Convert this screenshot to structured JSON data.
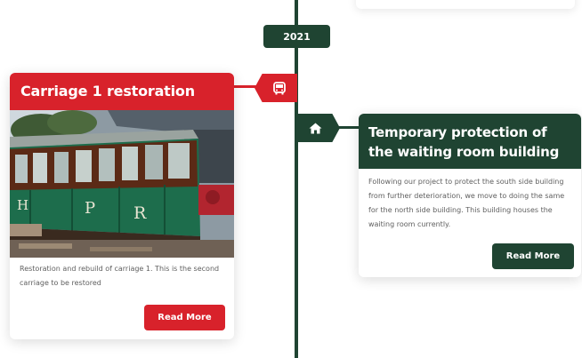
{
  "timeline": {
    "year": "2021"
  },
  "entries": [
    {
      "title": "Carriage 1 restoration",
      "description": "Restoration and rebuild of carriage 1. This is the second carriage to be restored",
      "button_label": "Read More",
      "marker_icon": "bus-icon",
      "accent": "#d8222b",
      "photo_letters": [
        "H",
        "P",
        "R"
      ]
    },
    {
      "title": "Temporary protection of the waiting room building",
      "description": "Following our project to protect the south side building from further deterioration, we move to doing the same for the north side building. This building houses the waiting room currently.",
      "button_label": "Read More",
      "marker_icon": "home-icon",
      "accent": "#1f4432"
    }
  ]
}
